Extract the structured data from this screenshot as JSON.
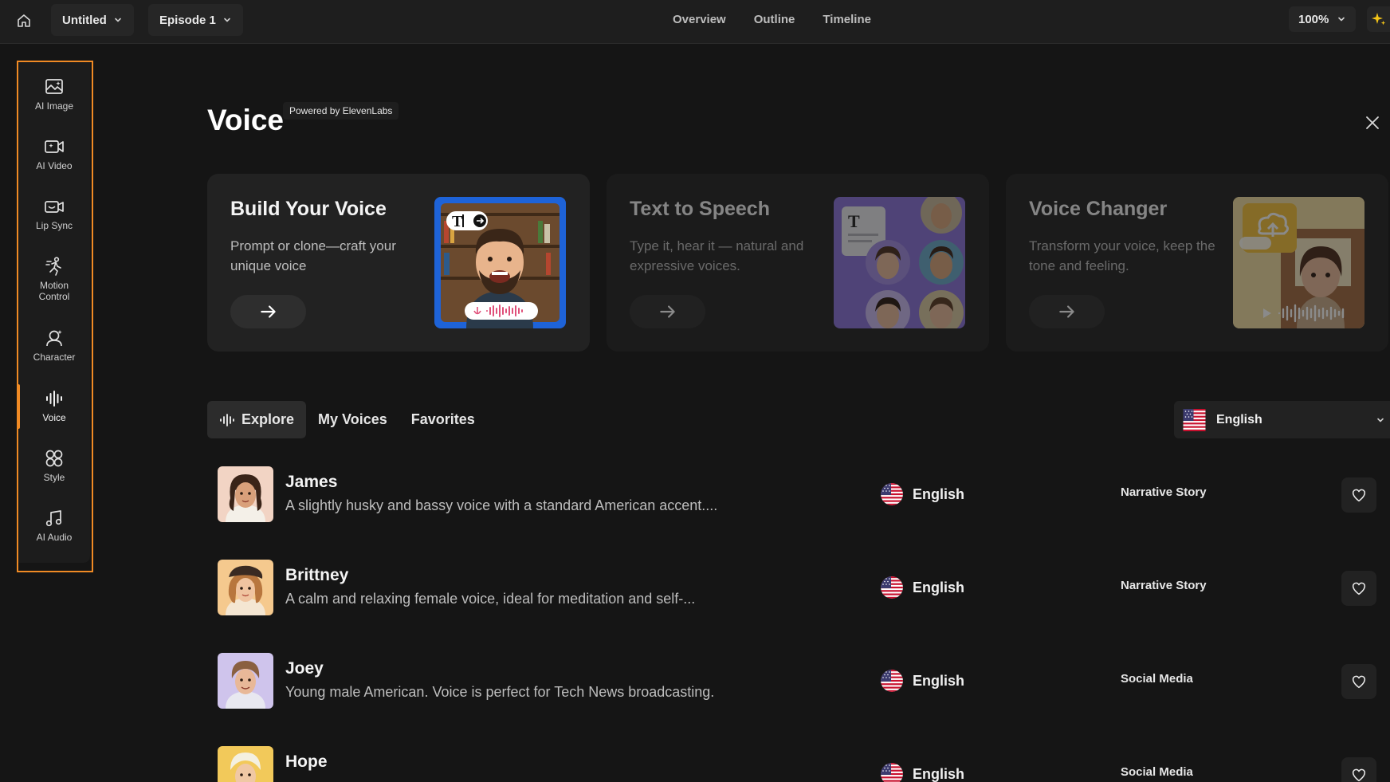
{
  "topbar": {
    "project_label": "Untitled",
    "episode_label": "Episode 1",
    "nav_tabs": [
      "Overview",
      "Outline",
      "Timeline"
    ],
    "zoom_label": "100%"
  },
  "sidebar": {
    "items": [
      {
        "label": "AI Image",
        "icon": "ai-image-icon"
      },
      {
        "label": "AI Video",
        "icon": "ai-video-icon"
      },
      {
        "label": "Lip Sync",
        "icon": "lip-sync-icon"
      },
      {
        "label": "Motion Control",
        "icon": "motion-control-icon"
      },
      {
        "label": "Character",
        "icon": "character-icon"
      },
      {
        "label": "Voice",
        "icon": "voice-icon",
        "active": true
      },
      {
        "label": "Style",
        "icon": "style-icon"
      },
      {
        "label": "AI Audio",
        "icon": "ai-audio-icon"
      }
    ],
    "highlight_color": "#f08a24"
  },
  "header": {
    "title": "Voice",
    "powered_by": "Powered by ElevenLabs"
  },
  "cards": [
    {
      "title": "Build Your Voice",
      "description": "Prompt or clone—craft your unique voice",
      "enabled": true
    },
    {
      "title": "Text to Speech",
      "description": "Type it, hear it — natural and expressive voices.",
      "enabled": false
    },
    {
      "title": "Voice Changer",
      "description": "Transform your voice, keep the tone and feeling.",
      "enabled": false
    }
  ],
  "tabs": {
    "items": [
      "Explore",
      "My Voices",
      "Favorites"
    ],
    "active": "Explore"
  },
  "language_filter": {
    "value": "English"
  },
  "voices": [
    {
      "name": "James",
      "description": "A slightly husky and bassy voice with a standard American accent....",
      "language": "English",
      "category": "Narrative Story"
    },
    {
      "name": "Brittney",
      "description": "A calm and relaxing female voice, ideal for meditation and self-...",
      "language": "English",
      "category": "Narrative Story"
    },
    {
      "name": "Joey",
      "description": "Young male American. Voice is perfect for Tech News broadcasting.",
      "language": "English",
      "category": "Social Media"
    },
    {
      "name": "Hope",
      "description": "",
      "language": "English",
      "category": "Social Media"
    }
  ]
}
